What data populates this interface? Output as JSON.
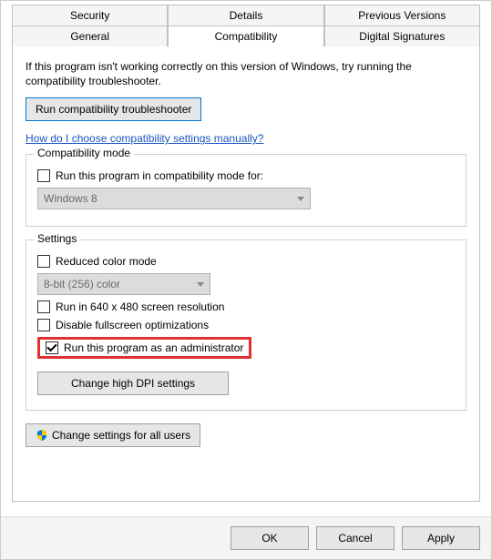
{
  "tabs": {
    "row1": [
      "Security",
      "Details",
      "Previous Versions"
    ],
    "row2": [
      "General",
      "Compatibility",
      "Digital Signatures"
    ],
    "active": "Compatibility"
  },
  "intro": "If this program isn't working correctly on this version of Windows, try running the compatibility troubleshooter.",
  "troubleshooter_btn": "Run compatibility troubleshooter",
  "help_link": "How do I choose compatibility settings manually?",
  "group_compat": {
    "title": "Compatibility mode",
    "checkbox_label": "Run this program in compatibility mode for:",
    "checkbox_checked": false,
    "select_value": "Windows 8"
  },
  "group_settings": {
    "title": "Settings",
    "reduced_color": {
      "label": "Reduced color mode",
      "checked": false
    },
    "color_select_value": "8-bit (256) color",
    "run_640": {
      "label": "Run in 640 x 480 screen resolution",
      "checked": false
    },
    "disable_fullscreen": {
      "label": "Disable fullscreen optimizations",
      "checked": false
    },
    "run_admin": {
      "label": "Run this program as an administrator",
      "checked": true
    },
    "dpi_btn": "Change high DPI settings"
  },
  "all_users_btn": "Change settings for all users",
  "buttons": {
    "ok": "OK",
    "cancel": "Cancel",
    "apply": "Apply"
  }
}
